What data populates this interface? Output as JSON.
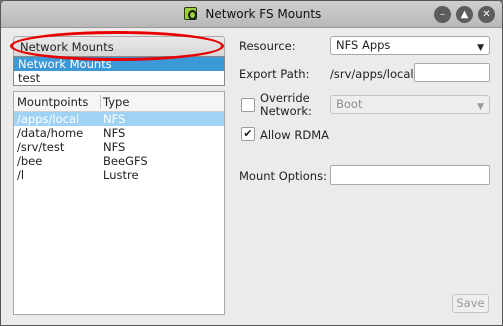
{
  "window": {
    "title": "Network FS Mounts",
    "buttons": {
      "minimize": "–",
      "maximize": "▲",
      "close": "✕"
    }
  },
  "mounts_combo": {
    "selected": "Network Mounts",
    "popup_options": [
      "Network Mounts",
      "test"
    ],
    "highlighted_index": 0
  },
  "mounts_table": {
    "columns": [
      "Mountpoints",
      "Type"
    ],
    "rows": [
      {
        "mountpoint": "/apps/local",
        "type": "NFS"
      },
      {
        "mountpoint": "/data/home",
        "type": "NFS"
      },
      {
        "mountpoint": "/srv/test",
        "type": "NFS"
      },
      {
        "mountpoint": "/bee",
        "type": "BeeGFS"
      },
      {
        "mountpoint": "/l",
        "type": "Lustre"
      }
    ],
    "selected_index": 0
  },
  "form": {
    "resource_label": "Resource:",
    "resource_value": "NFS Apps",
    "export_path_label": "Export Path:",
    "export_path_prefix": "/srv/apps/local/",
    "export_path_value": "",
    "override_network_label_line1": "Override",
    "override_network_label_line2": "Network:",
    "override_network_checked": false,
    "network_value": "Boot",
    "allow_rdma_label": "Allow RDMA",
    "allow_rdma_checked": true,
    "mount_options_label": "Mount Options:",
    "mount_options_value": ""
  },
  "footer": {
    "save_label": "Save"
  },
  "annotation": {
    "color": "#e80000"
  }
}
